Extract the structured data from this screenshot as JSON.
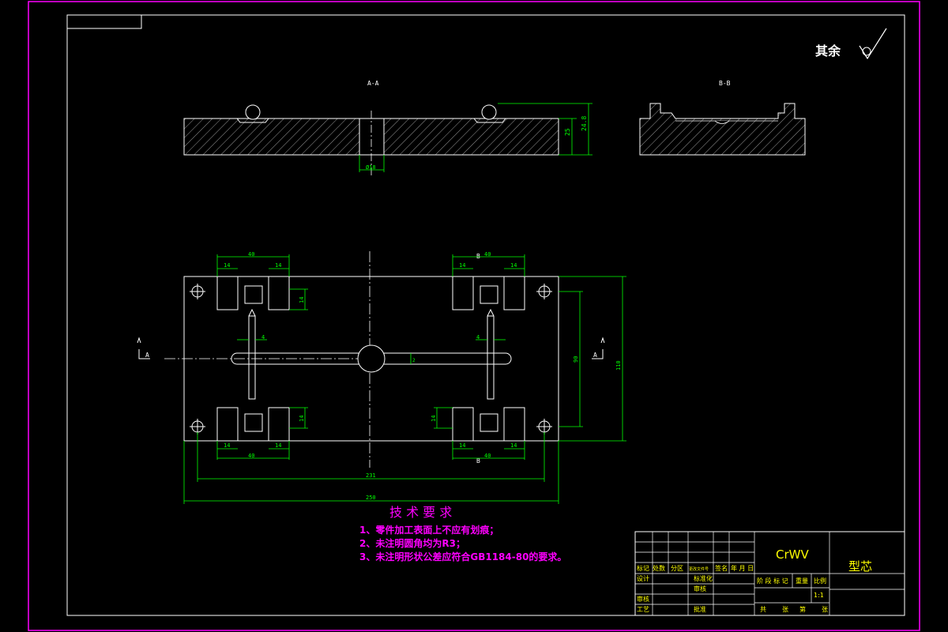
{
  "colors": {
    "frame": "#ff00ff",
    "lines": "#ffffff",
    "dims": "#00ff00",
    "notes": "#ff00ff",
    "titleblock_text": "#ffff00",
    "background": "#000000"
  },
  "surface_finish": {
    "label": "其余"
  },
  "views": {
    "section_aa": {
      "label": "A-A",
      "dim_depth": "25",
      "dim_height": "24.8",
      "dim_hole": "Ø18"
    },
    "section_bb": {
      "label": "B-B"
    },
    "plan": {
      "cut_a_left": "A",
      "cut_a_right": "A",
      "cut_b_top": "B",
      "cut_b_bottom": "B",
      "dims": {
        "d14": "14",
        "d40": "40",
        "d4": "4",
        "d2": "2",
        "d90": "90",
        "d110": "110",
        "d231": "231",
        "d250": "250"
      }
    }
  },
  "tech_requirements": {
    "title": "技 术 要 求",
    "items": [
      "1、零件加工表面上不应有划痕；",
      "2、未注明圆角均为R3；",
      "3、未注明形状公差应符合GB1184-80的要求。"
    ]
  },
  "title_block": {
    "material": "CrWV",
    "part_name": "型芯",
    "scale_label": "比例",
    "scale_value": "1:1",
    "row_change": [
      "标记",
      "处数",
      "分区",
      "更改文件号",
      "签名",
      "年 月 日"
    ],
    "row_design": "设计",
    "row_std": "标准化",
    "row_review": "审核",
    "row_process": "工艺",
    "row_check": "审核",
    "row_approve": "批准",
    "row_stage": [
      "阶 段 标 记",
      "重量",
      "比例"
    ],
    "row_bottom": [
      "共",
      "张",
      "第",
      "张"
    ]
  }
}
